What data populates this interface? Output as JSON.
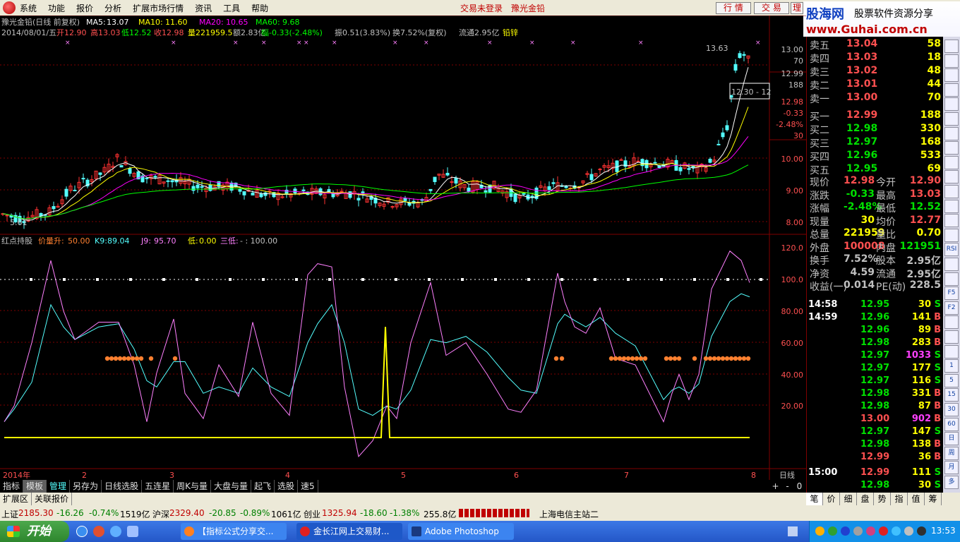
{
  "menubar": {
    "items": [
      "系统",
      "功能",
      "报价",
      "分析",
      "扩展市场行情",
      "资讯",
      "工具",
      "帮助"
    ],
    "login_warning": "交易未登录",
    "stock_link": "豫光金铅",
    "btn_quote": "行 情",
    "btn_trade": "交 易",
    "btn_more": "理"
  },
  "brand": {
    "name": "股海网",
    "slogan": "股票软件资源分享",
    "url": "www.Guhai.com.cn"
  },
  "price_chart": {
    "title": "豫光金铅(日线 前复权)",
    "ma5_label": "MA5:",
    "ma5_value": "13.07",
    "ma10_label": "MA10:",
    "ma10_value": "11.60",
    "ma20_label": "MA20:",
    "ma20_value": "10.65",
    "ma60_label": "MA60:",
    "ma60_value": "9.68",
    "info_date": "2014/08/01/五",
    "info_open": "开12.90",
    "info_high": "高13.03",
    "info_low": "低12.52",
    "info_close": "收12.98",
    "info_volume": "量221959.5",
    "info_amount": "额2.83亿",
    "info_change": "幅-0.33(-2.48%)",
    "info_amp": "振0.51(3.83%)",
    "info_turnover": "换7.52%(复权)",
    "info_float": "流通2.95亿",
    "info_sector": "铅锌",
    "annot_high": "13.63",
    "annot_low": "5.61",
    "annot_range": "12.30 - 12",
    "axis_ticks": [
      "13.00",
      "70",
      "12.99",
      "188",
      "12.98",
      "-0.33",
      "-2.48%",
      "30",
      "10.00",
      "9.00",
      "8.00"
    ],
    "colors": {
      "ma5": "#ffffff",
      "ma10": "#ffff00",
      "ma20": "#ff00ff",
      "ma60": "#00ff00",
      "up": "#ff3232",
      "down": "#54ffff"
    }
  },
  "indicator": {
    "name": "红点持股",
    "p1_label": "价量升:",
    "p1_value": "50.00",
    "p2_label": "K9:",
    "p2_value": "89.04",
    "p3_label": "J9:",
    "p3_value": "95.70",
    "p4_label": "低:",
    "p4_value": "0.00",
    "p5_label": "三低:",
    "p5_value": "- : 100.00",
    "axis_ticks": [
      "120.0",
      "100.0",
      "80.00",
      "60.00",
      "40.00",
      "20.00"
    ],
    "colors": {
      "k": "#54ffff",
      "j": "#ff80ff",
      "low": "#ffff00",
      "dots": "#ff8030",
      "ref": "#ffffff"
    }
  },
  "x_axis": {
    "labels": [
      "2014年",
      "2",
      "3",
      "4",
      "5",
      "6",
      "7",
      "8"
    ],
    "period": "日线"
  },
  "orderbook": {
    "asks": [
      {
        "label": "卖五",
        "price": "13.04",
        "vol": "58"
      },
      {
        "label": "卖四",
        "price": "13.03",
        "vol": "18"
      },
      {
        "label": "卖三",
        "price": "13.02",
        "vol": "48"
      },
      {
        "label": "卖二",
        "price": "13.01",
        "vol": "44"
      },
      {
        "label": "卖一",
        "price": "13.00",
        "vol": "70"
      }
    ],
    "bids": [
      {
        "label": "买一",
        "price": "12.99",
        "vol": "188"
      },
      {
        "label": "买二",
        "price": "12.98",
        "vol": "330"
      },
      {
        "label": "买三",
        "price": "12.97",
        "vol": "168"
      },
      {
        "label": "买四",
        "price": "12.96",
        "vol": "533"
      },
      {
        "label": "买五",
        "price": "12.95",
        "vol": "69"
      }
    ]
  },
  "quote": [
    {
      "l1": "现价",
      "v1": "12.98",
      "l2": "今开",
      "v2": "12.90"
    },
    {
      "l1": "涨跌",
      "v1": "-0.33",
      "l2": "最高",
      "v2": "13.03"
    },
    {
      "l1": "涨幅",
      "v1": "-2.48%",
      "l2": "最低",
      "v2": "12.52"
    },
    {
      "l1": "现量",
      "v1": "30",
      "l2": "均价",
      "v2": "12.77"
    },
    {
      "l1": "总量",
      "v1": "221959",
      "l2": "量比",
      "v2": "0.70"
    },
    {
      "l1": "外盘",
      "v1": "100008",
      "l2": "内盘",
      "v2": "121951"
    },
    {
      "l1": "换手",
      "v1": "7.52%",
      "l2": "股本",
      "v2": "2.95亿"
    },
    {
      "l1": "净资",
      "v1": "4.59",
      "l2": "流通",
      "v2": "2.95亿"
    },
    {
      "l1": "收益(一)",
      "v1": "0.014",
      "l2": "PE(动)",
      "v2": "228.5"
    }
  ],
  "ticks": [
    {
      "time": "14:58",
      "price": "12.95",
      "vol": "30",
      "side": "S"
    },
    {
      "time": "14:59",
      "price": "12.96",
      "vol": "141",
      "side": "B"
    },
    {
      "time": "",
      "price": "12.96",
      "vol": "89",
      "side": "B"
    },
    {
      "time": "",
      "price": "12.98",
      "vol": "283",
      "side": "B"
    },
    {
      "time": "",
      "price": "12.97",
      "vol": "1033",
      "side": "S"
    },
    {
      "time": "",
      "price": "12.97",
      "vol": "177",
      "side": "S"
    },
    {
      "time": "",
      "price": "12.97",
      "vol": "116",
      "side": "S"
    },
    {
      "time": "",
      "price": "12.98",
      "vol": "331",
      "side": "B"
    },
    {
      "time": "",
      "price": "12.98",
      "vol": "87",
      "side": "B"
    },
    {
      "time": "",
      "price": "13.00",
      "vol": "902",
      "side": "B"
    },
    {
      "time": "",
      "price": "12.97",
      "vol": "147",
      "side": "S"
    },
    {
      "time": "",
      "price": "12.98",
      "vol": "138",
      "side": "B"
    },
    {
      "time": "",
      "price": "12.99",
      "vol": "36",
      "side": "B"
    },
    {
      "time": "15:00",
      "price": "12.99",
      "vol": "111",
      "side": "S"
    },
    {
      "time": "",
      "price": "12.98",
      "vol": "30",
      "side": "S"
    }
  ],
  "toolstrip": [
    "",
    "",
    "",
    "",
    "",
    "",
    "",
    "",
    "",
    "",
    "",
    "",
    "",
    "",
    "RSI",
    "",
    "",
    "F5",
    "F2",
    "",
    "",
    "",
    "1",
    "5",
    "15",
    "30",
    "60",
    "日",
    "周",
    "月",
    "多"
  ],
  "bottom_tabs": [
    "指标",
    "模板",
    "管理",
    "另存为",
    "日线选股",
    "五连星",
    "周K与量",
    "大盘与量",
    "起飞",
    "选股",
    "速5"
  ],
  "bottom_tabs2": [
    "扩展区",
    "关联报价"
  ],
  "zoom_ctrl": [
    "+",
    "-",
    "0"
  ],
  "panel_tabs": [
    "笔",
    "价",
    "细",
    "盘",
    "势",
    "指",
    "值",
    "筹"
  ],
  "status": {
    "sh_label": "上证",
    "sh_val": "2185.30",
    "sh_chg": "-16.26",
    "sh_pct": "-0.74%",
    "sh_amt": "1519亿",
    "sz_label": "沪深",
    "sz_val": "2329.40",
    "sz_chg": "-20.85",
    "sz_pct": "-0.89%",
    "sz_amt": "1061亿",
    "cy_label": "创业",
    "cy_val": "1325.94",
    "cy_chg": "-18.60",
    "cy_pct": "-1.38%",
    "cy_amt": "255.8亿",
    "server": "上海电信主站二"
  },
  "taskbar": {
    "start": "开始",
    "task1": "【指标公式分享交...",
    "task2": "金长江网上交易财...",
    "task3": "Adobe Photoshop",
    "clock": "13:53"
  }
}
